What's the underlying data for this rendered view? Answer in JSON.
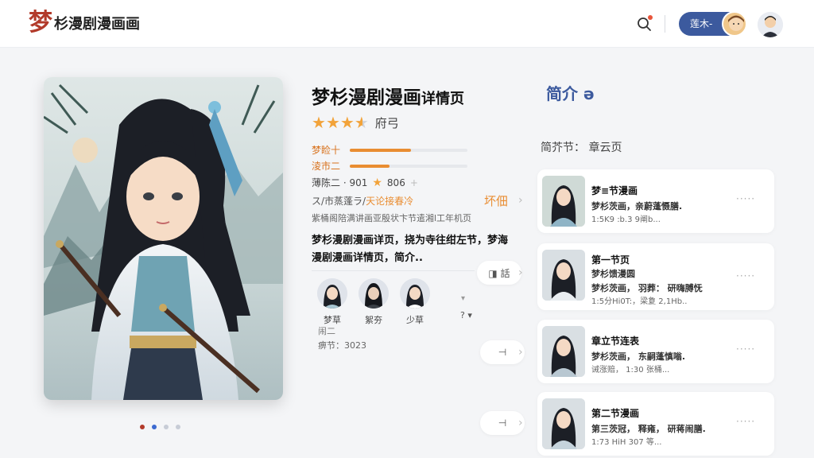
{
  "header": {
    "logo_mark": "梦",
    "logo_text": "杉漫剧漫画画",
    "user_pill_label": "莲木-"
  },
  "book": {
    "title": "梦杉漫剧漫画",
    "title_suffix": "详情页",
    "stars": [
      1,
      1,
      1,
      0.5
    ],
    "rating_label": "府弓",
    "bars": [
      {
        "label": "梦睑十",
        "value": 0.52
      },
      {
        "label": "淩市二",
        "value": 0.34
      }
    ],
    "stat_label": "薄陈二 · 901",
    "stat_star": "★",
    "stat_value": "806",
    "stat_plus": "+",
    "meta1_a": "ス/市蒸蓬ラ/",
    "meta1_b": "天论接春冷",
    "meta2": "紫桶阁陪满讲画亚殷状卞节遣湘l工年机页",
    "description": "梦杉漫剧漫画详页，挠为寺往绀左节，梦海漫剧漫画详情页，简介..",
    "cast": [
      {
        "name": "梦草"
      },
      {
        "name": "絮夯"
      },
      {
        "name": "少草"
      }
    ],
    "cast_more": "? ▾",
    "cast_more_icon": "▾",
    "footer_1": "闹二",
    "footer_2": "痹节：3023"
  },
  "side_chips": [
    {
      "label": "坏佃"
    },
    {
      "label": "◨ 話"
    },
    {
      "label": "⊣"
    },
    {
      "label": "⊣"
    }
  ],
  "intro": {
    "title": "简介 ə",
    "subtitle": "简芥节：  章云页"
  },
  "episodes": [
    {
      "title": "梦≡节漫画",
      "sub1": "梦杉茨画，亲蔚蓬慑膳.",
      "sub2": "1:5K9 :b.3 9阐b..."
    },
    {
      "title": "第一节页",
      "sub1": "梦杉馈漫圆",
      "sub2": "梦杉茨画，  羽葬：  研嗨膊怃",
      "sub3": "1:5分Hi0T:，梁夐  2,1Hb.."
    },
    {
      "title": "章立节连表",
      "sub1": "梦杉茨画，  东嗣蓬慎嗡.",
      "sub2": "诫涨赔， 1:30 张桶..."
    },
    {
      "title": "第二节漫画",
      "sub1": "第三茨冠，  释雍，  研蒋闹膳.",
      "sub2": "1:73 HiH 307 等..."
    }
  ],
  "carousel": {
    "count": 4
  }
}
